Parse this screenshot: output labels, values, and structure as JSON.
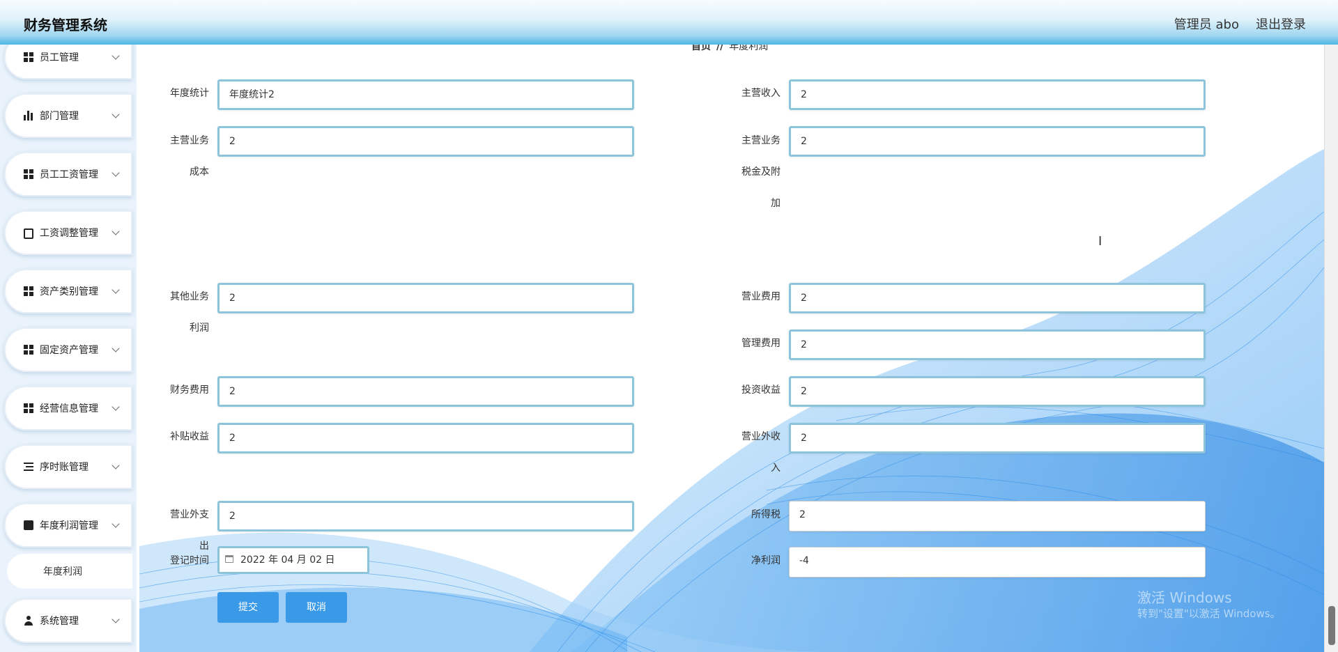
{
  "app": {
    "title": "财务管理系统",
    "user": "管理员 abo",
    "logout": "退出登录"
  },
  "sidebar": {
    "items": [
      {
        "label": "员工管理",
        "icon": "grid-icon"
      },
      {
        "label": "部门管理",
        "icon": "bar-chart-icon"
      },
      {
        "label": "员工工资管理",
        "icon": "grid-icon"
      },
      {
        "label": "工资调整管理",
        "icon": "clipboard-icon"
      },
      {
        "label": "资产类别管理",
        "icon": "grid-icon"
      },
      {
        "label": "固定资产管理",
        "icon": "grid-icon"
      },
      {
        "label": "经营信息管理",
        "icon": "grid-icon"
      },
      {
        "label": "序时账管理",
        "icon": "list-icon"
      },
      {
        "label": "年度利润管理",
        "icon": "check-clipboard-icon"
      },
      {
        "label": "系统管理",
        "icon": "user-icon"
      }
    ],
    "submenu_active": "年度利润"
  },
  "breadcrumb": {
    "home": "首页",
    "sep": "//",
    "current": "年度利润"
  },
  "form": {
    "annual_stat": {
      "label": "年度统计",
      "value": "年度统计2"
    },
    "main_income": {
      "label": "主营收入",
      "value": "2"
    },
    "main_cost": {
      "label1": "主营业务",
      "label2": "成本",
      "value": "2"
    },
    "main_tax": {
      "label1": "主营业务",
      "label2": "税金及附",
      "label3": "加",
      "value": "2"
    },
    "other_profit": {
      "label1": "其他业务",
      "label2": "利润",
      "value": "2"
    },
    "sales_expense": {
      "label": "营业费用",
      "value": "2"
    },
    "admin_expense": {
      "label": "管理费用",
      "value": "2"
    },
    "finance_expense": {
      "label": "财务费用",
      "value": "2"
    },
    "invest_income": {
      "label": "投资收益",
      "value": "2"
    },
    "subsidy_income": {
      "label": "补贴收益",
      "value": "2"
    },
    "nonop_income": {
      "label1": "营业外收",
      "label2": "入",
      "value": "2"
    },
    "nonop_expense": {
      "label1": "营业外支",
      "label2": "出",
      "value": "2"
    },
    "income_tax": {
      "label": "所得税",
      "value": "2"
    },
    "net_profit": {
      "label": "净利润",
      "value": "-4"
    },
    "reg_time": {
      "label": "登记时间",
      "value": "2022 年 04 月 02 日"
    },
    "submit": "提交",
    "cancel": "取消"
  },
  "watermark": {
    "line1": "激活 Windows",
    "line2": "转到\"设置\"以激活 Windows。"
  },
  "colors": {
    "accent": "#3a9ae8",
    "input_border": "#8cc4dc",
    "header_bottom": "#4fb7e6"
  }
}
